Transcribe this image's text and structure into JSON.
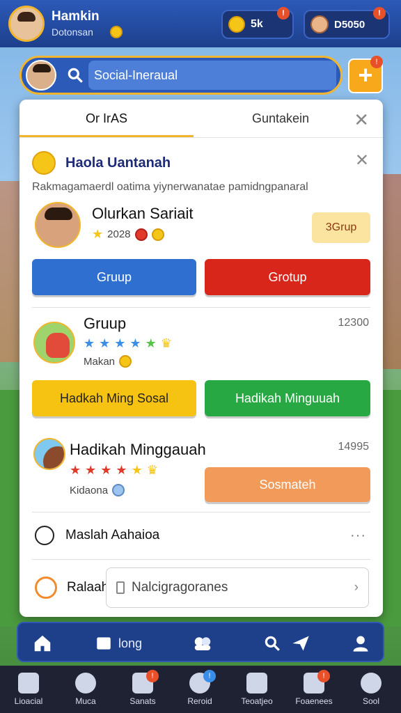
{
  "header": {
    "player_name": "Hamkin",
    "player_sub": "Dotonsan",
    "resource1_value": "5k",
    "resource2_value": "D5050"
  },
  "search": {
    "value": "Social-Ineraual"
  },
  "modal": {
    "tabs": [
      {
        "label": "Or IrAS"
      },
      {
        "label": "Guntakein"
      }
    ],
    "section": {
      "title": "Haola Uantanah",
      "subtitle": "Rakmagamaerdl oatima yiynerwanatae pamidngpanaral"
    },
    "players": [
      {
        "name": "Olurkan Sariait",
        "meta": "2028",
        "tag": "3Grup"
      },
      {
        "name": "Gruup",
        "meta": "Makan",
        "value": "12300"
      },
      {
        "name": "Hadikah Minggauah",
        "meta": "Kidaona",
        "value": "14995"
      }
    ],
    "buttons": {
      "row1_left": "Gruup",
      "row1_right": "Grotup",
      "row2_left": "Hadkah Ming Sosal",
      "row2_right": "Hadikah Minguuah",
      "row3_right": "Sosmateh"
    },
    "list_item": "Maslah Aahaioa",
    "bottom_label": "Ralaah",
    "bottom_input": "Nalcigragoranes"
  },
  "nav1": {
    "label": "long"
  },
  "nav2": [
    {
      "label": "Lioacial"
    },
    {
      "label": "Muca"
    },
    {
      "label": "Sanats"
    },
    {
      "label": "Reroid"
    },
    {
      "label": "Teoatjeo"
    },
    {
      "label": "Foaenees"
    },
    {
      "label": "Sool"
    }
  ],
  "colors": {
    "accent": "#f2b62e",
    "primary": "#2c5ab8"
  }
}
